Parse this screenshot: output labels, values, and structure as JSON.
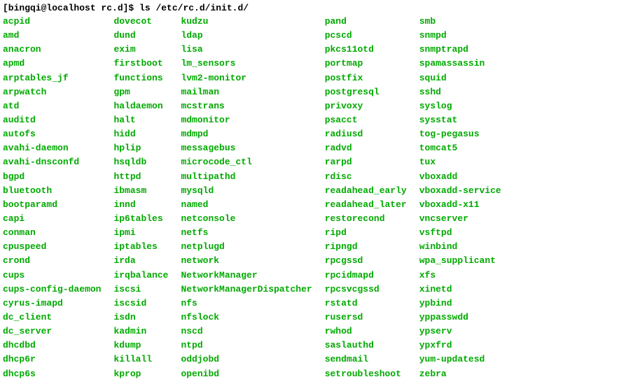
{
  "prompt": "[bingqi@localhost rc.d]$ ",
  "command": "ls /etc/rc.d/init.d/",
  "columns": [
    [
      "acpid",
      "amd",
      "anacron",
      "apmd",
      "arptables_jf",
      "arpwatch",
      "atd",
      "auditd",
      "autofs",
      "avahi-daemon",
      "avahi-dnsconfd",
      "bgpd",
      "bluetooth",
      "bootparamd",
      "capi",
      "conman",
      "cpuspeed",
      "crond",
      "cups",
      "cups-config-daemon",
      "cyrus-imapd",
      "dc_client",
      "dc_server",
      "dhcdbd",
      "dhcp6r",
      "dhcp6s"
    ],
    [
      "dovecot",
      "dund",
      "exim",
      "firstboot",
      "functions",
      "gpm",
      "haldaemon",
      "halt",
      "hidd",
      "hplip",
      "hsqldb",
      "httpd",
      "ibmasm",
      "innd",
      "ip6tables",
      "ipmi",
      "iptables",
      "irda",
      "irqbalance",
      "iscsi",
      "iscsid",
      "isdn",
      "kadmin",
      "kdump",
      "killall",
      "kprop"
    ],
    [
      "kudzu",
      "ldap",
      "lisa",
      "lm_sensors",
      "lvm2-monitor",
      "mailman",
      "mcstrans",
      "mdmonitor",
      "mdmpd",
      "messagebus",
      "microcode_ctl",
      "multipathd",
      "mysqld",
      "named",
      "netconsole",
      "netfs",
      "netplugd",
      "network",
      "NetworkManager",
      "NetworkManagerDispatcher",
      "nfs",
      "nfslock",
      "nscd",
      "ntpd",
      "oddjobd",
      "openibd"
    ],
    [
      "pand",
      "pcscd",
      "pkcs11otd",
      "portmap",
      "postfix",
      "postgresql",
      "privoxy",
      "psacct",
      "radiusd",
      "radvd",
      "rarpd",
      "rdisc",
      "readahead_early",
      "readahead_later",
      "restorecond",
      "ripd",
      "ripngd",
      "rpcgssd",
      "rpcidmapd",
      "rpcsvcgssd",
      "rstatd",
      "rusersd",
      "rwhod",
      "saslauthd",
      "sendmail",
      "setroubleshoot"
    ],
    [
      "smb",
      "snmpd",
      "snmptrapd",
      "spamassassin",
      "squid",
      "sshd",
      "syslog",
      "sysstat",
      "tog-pegasus",
      "tomcat5",
      "tux",
      "vboxadd",
      "vboxadd-service",
      "vboxadd-x11",
      "vncserver",
      "vsftpd",
      "winbind",
      "wpa_supplicant",
      "xfs",
      "xinetd",
      "ypbind",
      "yppasswdd",
      "ypserv",
      "ypxfrd",
      "yum-updatesd",
      "zebra"
    ]
  ]
}
